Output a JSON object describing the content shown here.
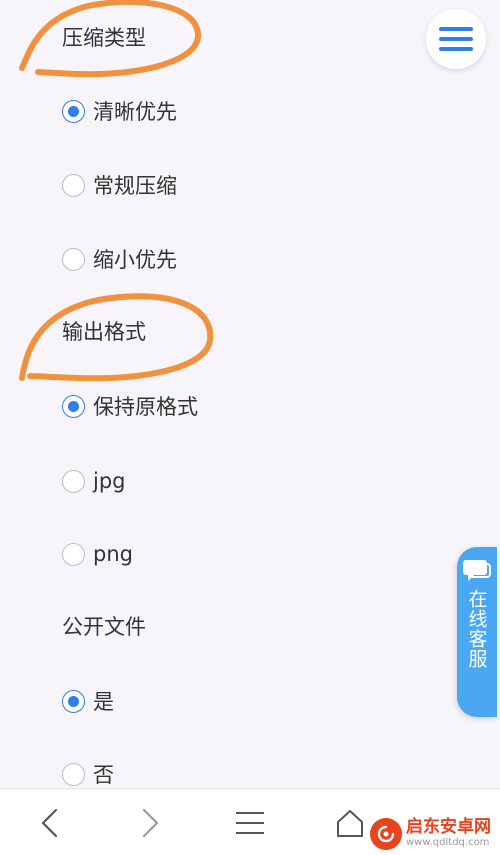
{
  "sections": {
    "compression": {
      "title": "压缩类型",
      "options": [
        {
          "label": "清晰优先",
          "checked": true
        },
        {
          "label": "常规压缩",
          "checked": false
        },
        {
          "label": "缩小优先",
          "checked": false
        }
      ]
    },
    "output": {
      "title": "输出格式",
      "options": [
        {
          "label": "保持原格式",
          "checked": true
        },
        {
          "label": "jpg",
          "checked": false
        },
        {
          "label": "png",
          "checked": false
        }
      ]
    },
    "public": {
      "title": "公开文件",
      "options": [
        {
          "label": "是",
          "checked": true
        },
        {
          "label": "否",
          "checked": false
        }
      ]
    }
  },
  "service": {
    "label": "在线客服",
    "icon": "chat-bubble-icon"
  },
  "menu": {
    "icon": "hamburger-menu-icon"
  },
  "nav": {
    "icons": [
      "back-arrow-icon",
      "forward-arrow-icon",
      "menu-lines-icon",
      "home-icon"
    ]
  },
  "watermark": {
    "name": "启东安卓网",
    "url": "www.qdltdq.com"
  },
  "colors": {
    "accent": "#2f7fe8",
    "annotation": "#f0913f",
    "service_tab": "#4aa8f2",
    "watermark": "#e8421e"
  }
}
